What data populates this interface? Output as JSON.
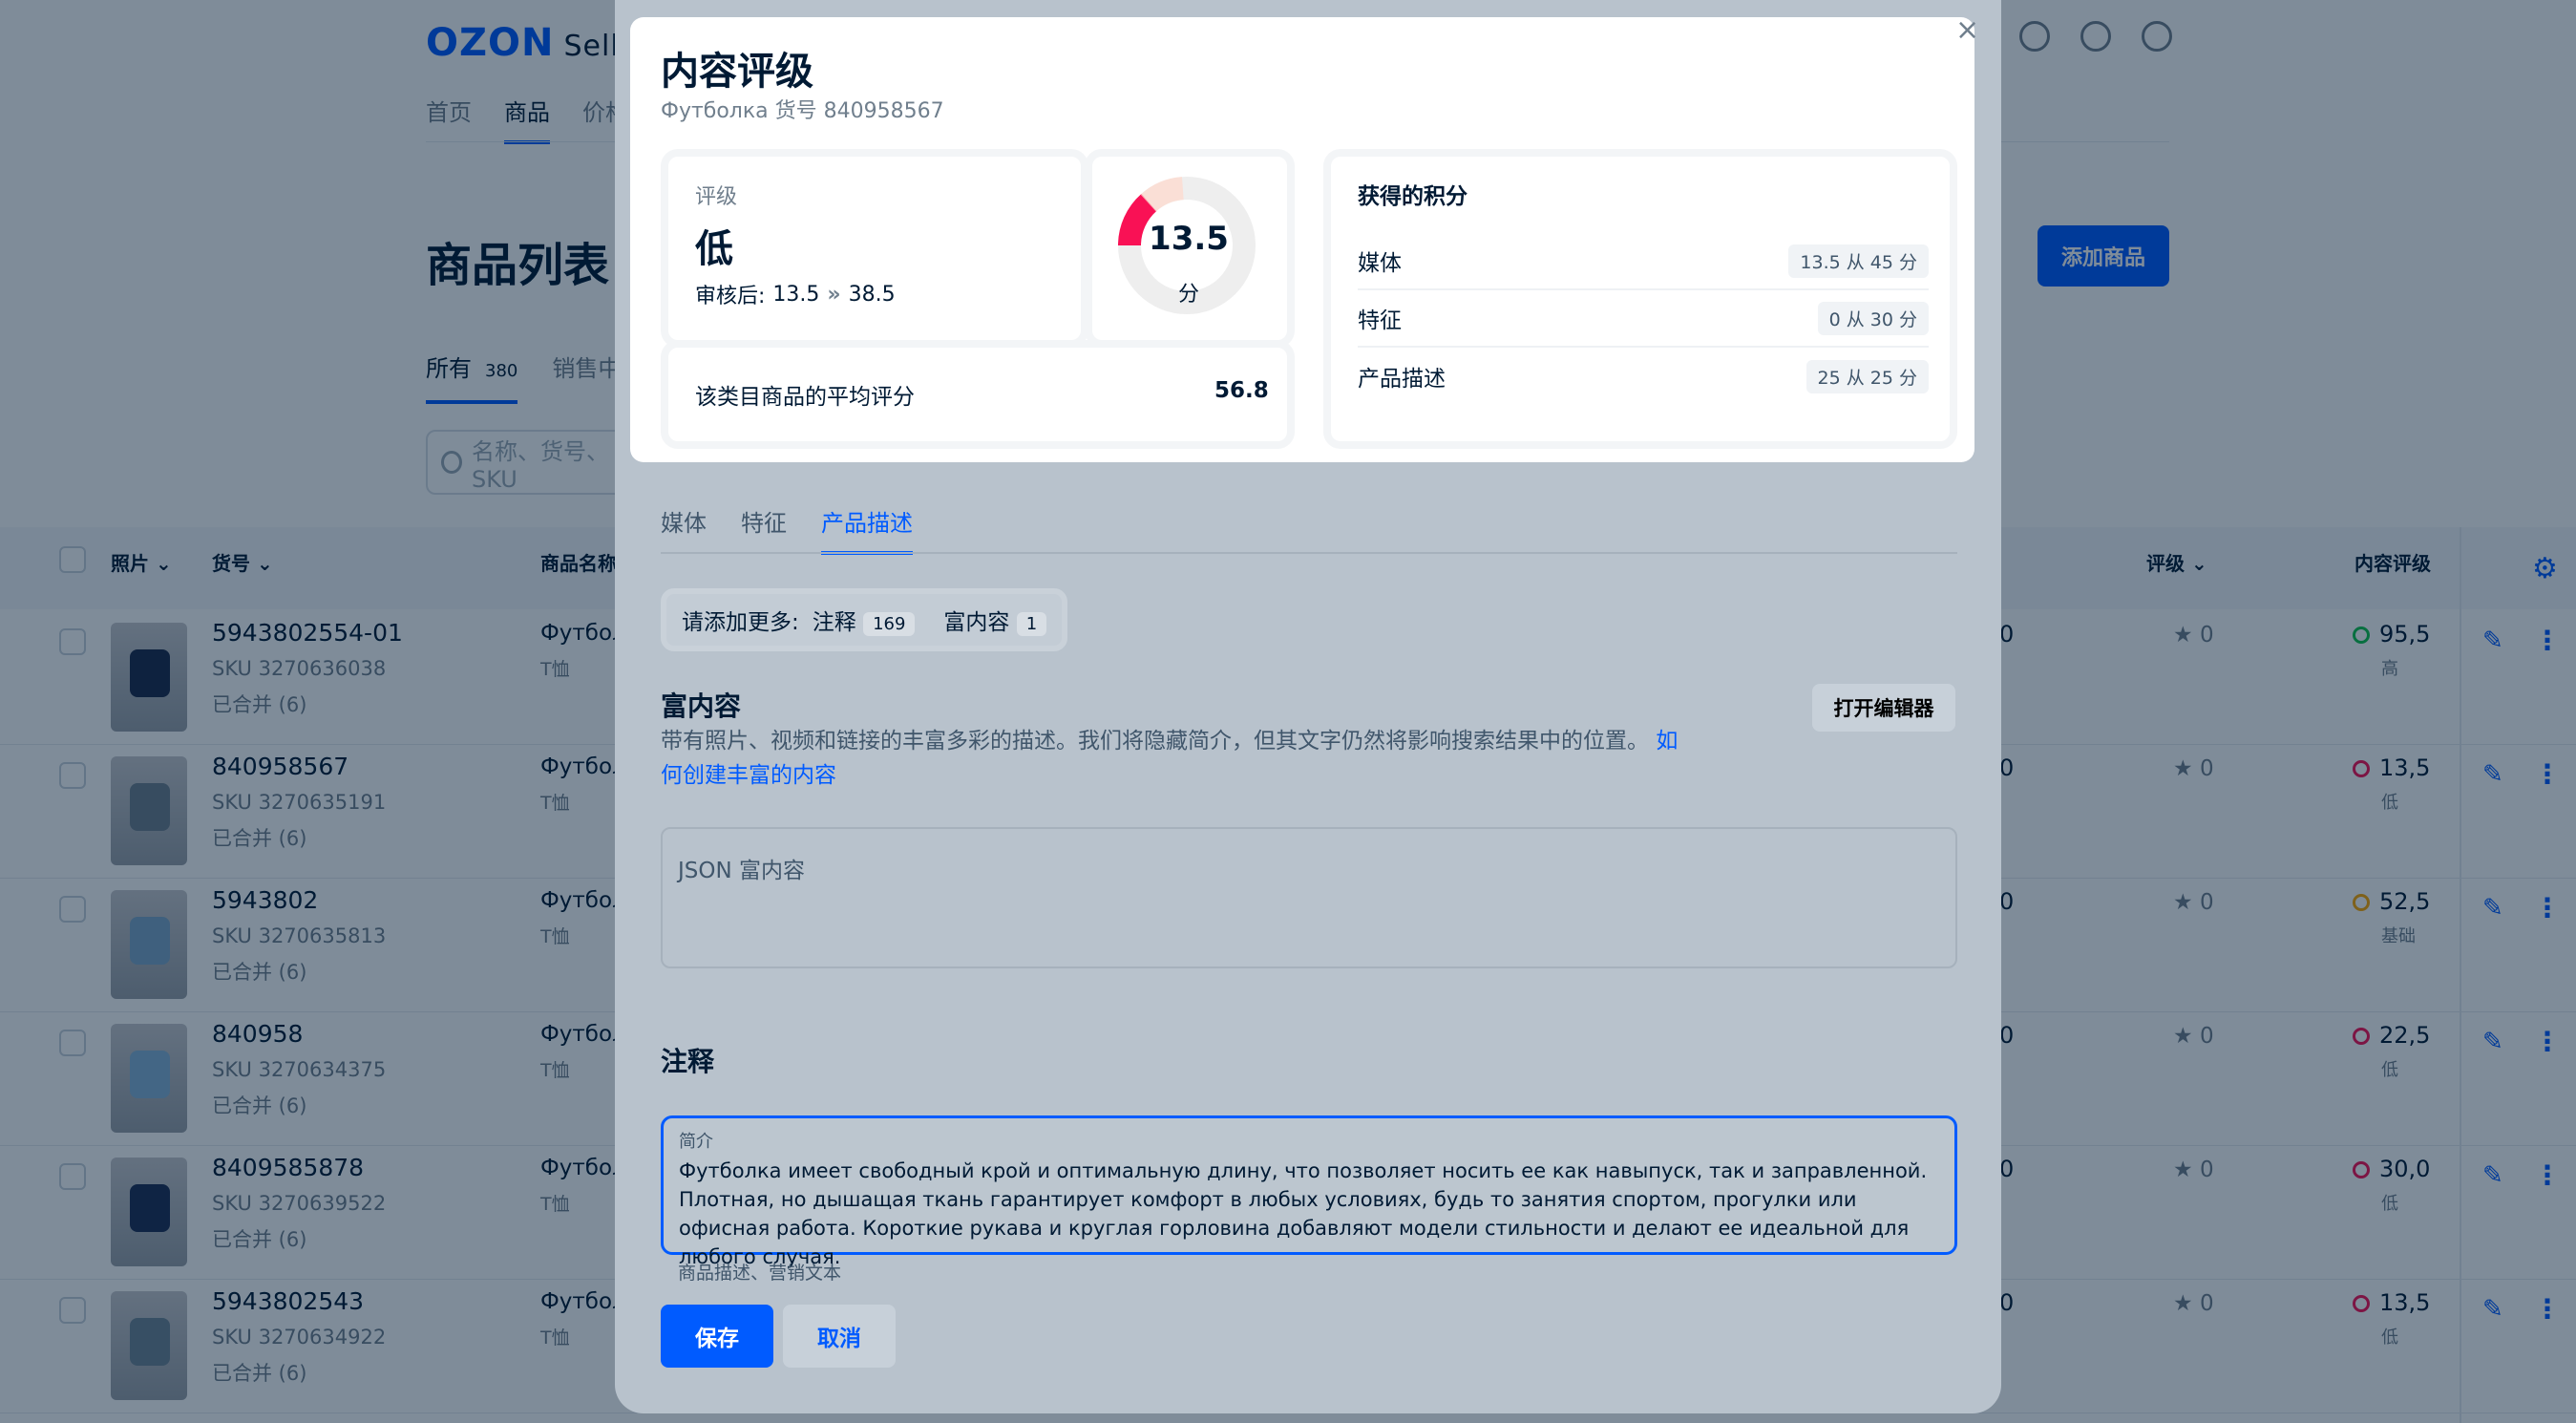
{
  "header": {
    "logo": "OZON",
    "logo_suffix": "Seller",
    "nav": [
      "首页",
      "商品",
      "价格"
    ]
  },
  "page": {
    "title": "商品列表",
    "add_button": "添加商品",
    "tabs": [
      {
        "label": "所有",
        "count": "380"
      },
      {
        "label": "销售中",
        "count": ""
      }
    ],
    "search_placeholder": "名称、货号、SKU"
  },
  "table": {
    "headers": {
      "photo": "照片",
      "article": "货号",
      "name": "商品名称",
      "rating": "评级",
      "content_rating": "内容评级"
    },
    "rows": [
      {
        "article": "5943802554-01",
        "sku": "SKU 3270636038",
        "merged": "已合并 (6)",
        "name": "Футболка",
        "type": "T恤",
        "col": "0",
        "rating": "0",
        "content": "95,5",
        "level": "高",
        "color": "#10c44c"
      },
      {
        "article": "840958567",
        "sku": "SKU 3270635191",
        "merged": "已合并 (6)",
        "name": "Футболка",
        "type": "T恤",
        "col": "0",
        "rating": "0",
        "content": "13,5",
        "level": "低",
        "color": "#f91155"
      },
      {
        "article": "5943802",
        "sku": "SKU 3270635813",
        "merged": "已合并 (6)",
        "name": "Футболка",
        "type": "T恤",
        "col": "0",
        "rating": "0",
        "content": "52,5",
        "level": "基础",
        "color": "#ffa800"
      },
      {
        "article": "840958",
        "sku": "SKU 3270634375",
        "merged": "已合并 (6)",
        "name": "Футболка",
        "type": "T恤",
        "col": "0",
        "rating": "0",
        "content": "22,5",
        "level": "低",
        "color": "#f91155"
      },
      {
        "article": "8409585878",
        "sku": "SKU 3270639522",
        "merged": "已合并 (6)",
        "name": "Футболка",
        "type": "T恤",
        "col": "0",
        "rating": "0",
        "content": "30,0",
        "level": "低",
        "color": "#f91155"
      },
      {
        "article": "5943802543",
        "sku": "SKU 3270634922",
        "merged": "已合并 (6)",
        "name": "Футболка",
        "type": "T恤",
        "col": "0",
        "rating": "0",
        "content": "13,5",
        "level": "低",
        "color": "#f91155"
      }
    ]
  },
  "modal": {
    "title": "内容评级",
    "subtitle": "Футболка 货号 840958567",
    "rating_label": "评级",
    "rating_value": "低",
    "after_review_label": "审核后:",
    "after_from": "13.5",
    "after_to": "38.5",
    "score": "13.5",
    "score_max": 100,
    "score_unit": "分",
    "avg_label": "该类目商品的平均评分",
    "avg_value": "56.8",
    "points_title": "获得的积分",
    "points": [
      {
        "label": "媒体",
        "value": "13.5 从 45 分"
      },
      {
        "label": "特征",
        "value": "0 从 30 分"
      },
      {
        "label": "产品描述",
        "value": "25 从 25 分"
      }
    ],
    "tabs": [
      "媒体",
      "特征",
      "产品描述"
    ],
    "add_more_label": "请添加更多:",
    "add_more": [
      {
        "label": "注释",
        "count": "169"
      },
      {
        "label": "富内容",
        "count": "1"
      }
    ],
    "rich_title": "富内容",
    "rich_desc": "带有照片、视频和链接的丰富多彩的描述。我们将隐藏简介，但其文字仍然将影响搜索结果中的位置。",
    "rich_link": "如何创建丰富的内容",
    "editor_button": "打开编辑器",
    "json_placeholder": "JSON 富内容",
    "annotation_title": "注释",
    "textarea_label": "简介",
    "textarea_text": "Футболка имеет свободный крой и оптимальную длину, что позволяет носить ее как навыпуск, так и заправленной. Плотная, но дышащая ткань гарантирует комфорт в любых условиях, будь то занятия спортом, прогулки или офисная работа. Короткие рукава и круглая горловина добавляют модели стильности и делают ее идеальной для любого случая.",
    "textarea_hint": "商品描述、营销文本",
    "save": "保存",
    "cancel": "取消"
  },
  "colors": {
    "accent": "#005bff",
    "low": "#f91155",
    "high": "#10c44c",
    "basic": "#ffa800"
  }
}
